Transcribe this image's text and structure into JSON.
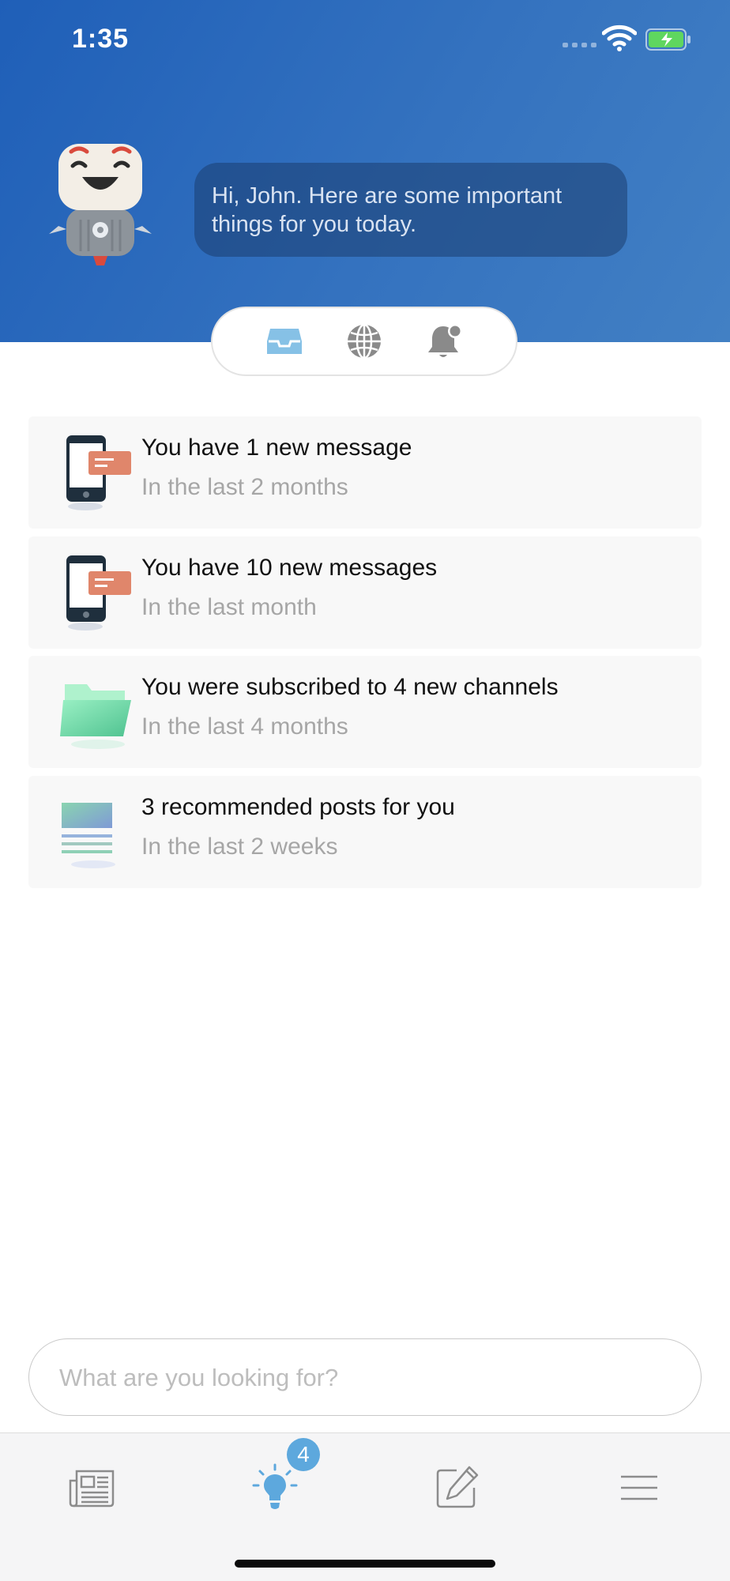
{
  "status_bar": {
    "time": "1:35"
  },
  "header": {
    "greeting": "Hi, John. Here are some important things for you today."
  },
  "segments": [
    {
      "name": "inbox",
      "icon": "inbox-icon",
      "active": true
    },
    {
      "name": "world",
      "icon": "globe-icon",
      "active": false
    },
    {
      "name": "notifications",
      "icon": "bell-icon",
      "active": false
    }
  ],
  "cards": [
    {
      "icon": "phone-message-icon",
      "title": "You have 1 new message",
      "subtitle": "In the last 2 months"
    },
    {
      "icon": "phone-message-icon",
      "title": "You have 10 new messages",
      "subtitle": "In the last month"
    },
    {
      "icon": "folder-icon",
      "title": "You were subscribed to 4 new channels",
      "subtitle": "In the last 4 months"
    },
    {
      "icon": "post-icon",
      "title": "3 recommended posts for you",
      "subtitle": "In the last 2 weeks"
    }
  ],
  "search": {
    "placeholder": "What are you looking for?"
  },
  "tabbar": {
    "items": [
      {
        "name": "news",
        "icon": "newspaper-icon"
      },
      {
        "name": "ideas",
        "icon": "lightbulb-icon",
        "badge": "4"
      },
      {
        "name": "compose",
        "icon": "pencil-icon"
      },
      {
        "name": "menu",
        "icon": "menu-icon"
      }
    ]
  },
  "colors": {
    "accent": "#5da8dd",
    "header_start": "#1f5fb8",
    "header_end": "#4280c4"
  }
}
